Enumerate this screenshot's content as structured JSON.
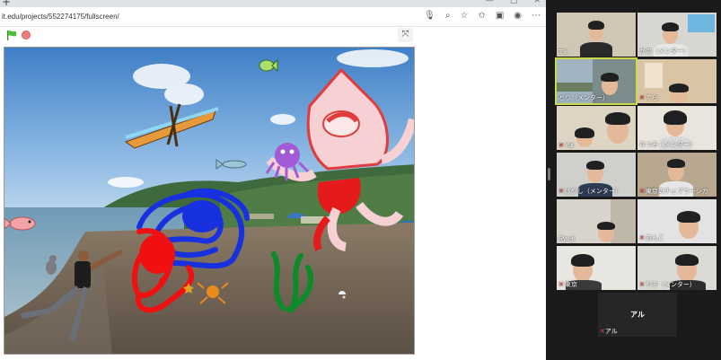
{
  "browser": {
    "url": "it.edu/projects/552274175/fullscreen/",
    "tab_plus": "+",
    "win_buttons": [
      "—",
      "▢",
      "✕"
    ],
    "addr_icons": [
      "mic-icon",
      "search-icon",
      "star-add-icon",
      "favorites-icon",
      "collections-icon",
      "profile-icon",
      "more-icon"
    ]
  },
  "scratch": {
    "green_flag": "green-flag-icon",
    "stop": "stop-icon",
    "fullscreen_glyph": "⤧"
  },
  "zoom": {
    "participants": [
      {
        "name": "T k",
        "mic_muted": false
      },
      {
        "name": "かの（メンター）",
        "mic_muted": false
      },
      {
        "name": "とり（メンター）",
        "mic_muted": false,
        "active": true
      },
      {
        "name": "てら",
        "mic_muted": true
      },
      {
        "name": "Yui",
        "mic_muted": true
      },
      {
        "name": "なつみ（メンター）",
        "mic_muted": false
      },
      {
        "name": "はやし（メンター）",
        "mic_muted": true
      },
      {
        "name": "東京のチェブラーシカ",
        "mic_muted": true
      },
      {
        "name": "Ryu-ji",
        "mic_muted": false
      },
      {
        "name": "あんこ",
        "mic_muted": true
      },
      {
        "name": "東京",
        "mic_muted": true
      },
      {
        "name": "やま（メンター）",
        "mic_muted": true
      }
    ],
    "solo": {
      "display_name": "アル",
      "label": "アル",
      "mic_muted": true
    }
  },
  "colors": {
    "accent_active": "#c9d94a",
    "mic_muted": "#e23b3b"
  }
}
